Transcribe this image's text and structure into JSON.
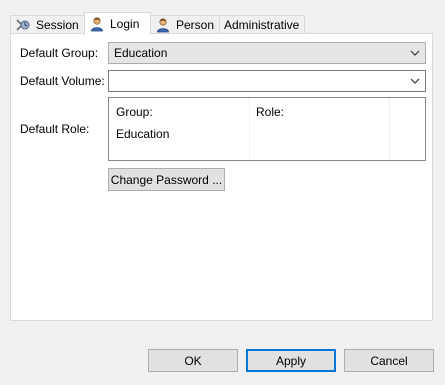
{
  "tabs": [
    {
      "label": "Session",
      "icon": "session-icon"
    },
    {
      "label": "Login",
      "icon": "user-icon"
    },
    {
      "label": "Person",
      "icon": "user-icon"
    },
    {
      "label": "Administrative",
      "icon": ""
    }
  ],
  "active_tab": "Login",
  "form": {
    "default_group_label": "Default Group:",
    "default_group_value": "Education",
    "default_volume_label": "Default Volume:",
    "default_volume_value": "",
    "default_role_label": "Default Role:",
    "role_table": {
      "headers": [
        "Group:",
        "Role:"
      ],
      "rows": [
        [
          "Education",
          ""
        ]
      ]
    },
    "change_password_label": "Change Password ..."
  },
  "buttons": {
    "ok": "OK",
    "apply": "Apply",
    "cancel": "Cancel"
  },
  "colors": {
    "accent": "#0078d7",
    "window_bg": "#f0f0f0"
  }
}
